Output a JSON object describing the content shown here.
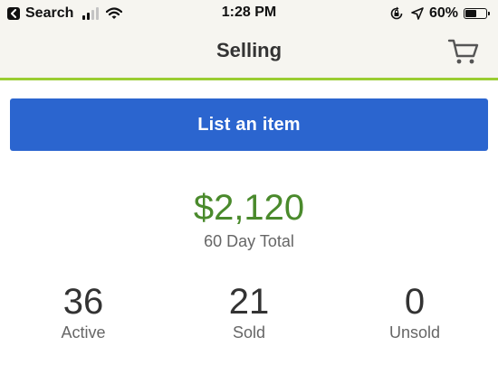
{
  "status_bar": {
    "back_label": "Search",
    "time": "1:28 PM",
    "battery_percent": "60%",
    "battery_level": 0.6,
    "signal_bars": 4,
    "signal_bars_active": 2,
    "icons": [
      "back-arrow-icon",
      "cellular-signal-icon",
      "wifi-icon",
      "orientation-lock-icon",
      "location-arrow-icon",
      "battery-icon"
    ]
  },
  "nav": {
    "title": "Selling",
    "cart_icon": "shopping-cart-icon",
    "accent_color": "#9acd32"
  },
  "actions": {
    "list_item_label": "List an item",
    "button_color": "#2b65cf"
  },
  "summary": {
    "total": "$2,120",
    "total_label": "60 Day Total",
    "total_color": "#4a8a2c"
  },
  "stats": [
    {
      "value": "36",
      "label": "Active"
    },
    {
      "value": "21",
      "label": "Sold"
    },
    {
      "value": "0",
      "label": "Unsold"
    }
  ]
}
